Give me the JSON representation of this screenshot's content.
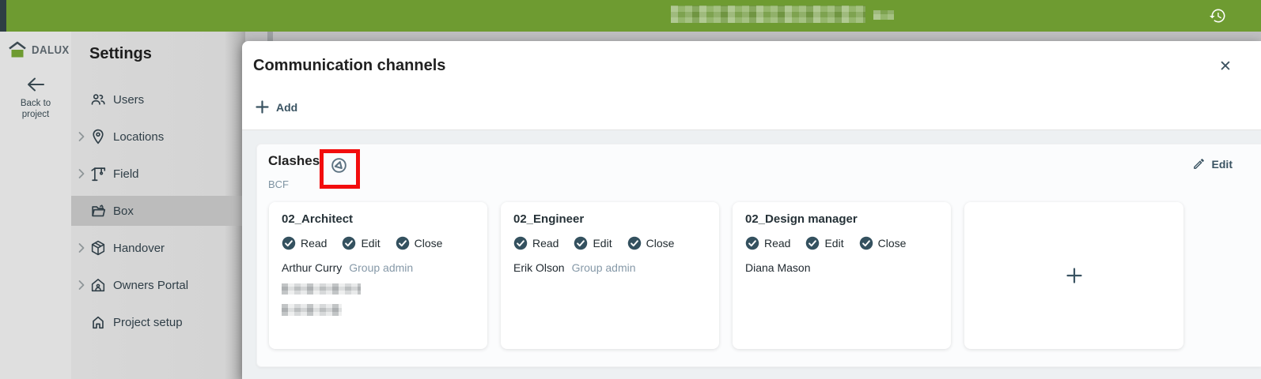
{
  "colors": {
    "brand_green": "#6e9b31",
    "slate_action": "#3a5362",
    "check_circle": "#34515f",
    "annotation_red": "#f20d0d",
    "member_role_text": "#8699a8",
    "sidebar_bg": "#d6d6d6",
    "modal_body_bg": "#edf0f2"
  },
  "icons": {
    "history": "clock-with-counterclockwise-arrow",
    "close": "x-mark",
    "add": "plus",
    "edit": "pencil",
    "permission_check": "check-in-filled-circle",
    "channel_badge": "bcf-swirl-circle",
    "back": "left-arrow",
    "expand": "chevron-right",
    "logo": "house-with-green-base"
  },
  "topbar": {
    "redacted_title": "pixelated"
  },
  "nav_rail": {
    "logo_text": "DALUX",
    "back_label": "Back to project"
  },
  "settings_menu": {
    "title": "Settings",
    "items": [
      {
        "label": "Users",
        "icon": "users-icon",
        "expandable": false,
        "selected": false
      },
      {
        "label": "Locations",
        "icon": "location-pin-icon",
        "expandable": true,
        "selected": false
      },
      {
        "label": "Field",
        "icon": "crane-icon",
        "expandable": true,
        "selected": false
      },
      {
        "label": "Box",
        "icon": "open-box-icon",
        "expandable": false,
        "selected": true
      },
      {
        "label": "Handover",
        "icon": "package-icon",
        "expandable": true,
        "selected": false
      },
      {
        "label": "Owners Portal",
        "icon": "owners-portal-icon",
        "expandable": true,
        "selected": false
      },
      {
        "label": "Project setup",
        "icon": "house-icon",
        "expandable": false,
        "selected": false
      }
    ]
  },
  "modal": {
    "title": "Communication channels",
    "close_label": "✕",
    "add_button": {
      "label": "Add"
    },
    "section": {
      "title": "Clashes",
      "subtitle": "BCF",
      "edit_button": {
        "label": "Edit"
      },
      "groups": [
        {
          "name": "02_Architect",
          "permissions": [
            "Read",
            "Edit",
            "Close"
          ],
          "member_name": "Arthur Curry",
          "member_role": "Group admin",
          "redacted_lines": 2
        },
        {
          "name": "02_Engineer",
          "permissions": [
            "Read",
            "Edit",
            "Close"
          ],
          "member_name": "Erik Olson",
          "member_role": "Group admin",
          "redacted_lines": 0
        },
        {
          "name": "02_Design manager",
          "permissions": [
            "Read",
            "Edit",
            "Close"
          ],
          "member_name": "Diana Mason",
          "member_role": "",
          "redacted_lines": 0
        }
      ]
    }
  }
}
